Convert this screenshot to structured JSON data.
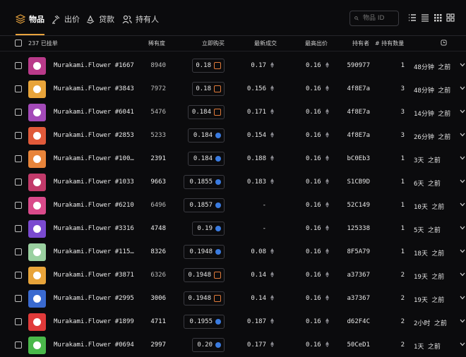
{
  "tabs": [
    {
      "label": "物品",
      "icon": "layers-icon",
      "active": true
    },
    {
      "label": "出价",
      "icon": "gavel-icon",
      "active": false
    },
    {
      "label": "贷款",
      "icon": "loan-icon",
      "active": false
    },
    {
      "label": "持有人",
      "icon": "users-icon",
      "active": false
    }
  ],
  "search": {
    "placeholder": "物品 ID"
  },
  "header": {
    "listed_count": "237 已挂单",
    "rarity": "稀有度",
    "buy_now": "立即购买",
    "last_sale": "最新成交",
    "top_bid": "最高出价",
    "owner": "持有者",
    "qty": "# 持有数量"
  },
  "colors": {
    "accent": "#e8a33d",
    "opensea": "#3a7be0",
    "blur": "#e17b3a"
  },
  "rows": [
    {
      "name": "Murakami.Flower #1667",
      "rarity": "8940",
      "price": "0.18",
      "market": "blur",
      "last": "0.17",
      "bid": "0.16",
      "owner": "590977",
      "qty": "1",
      "time": "48分钟 之前",
      "bg": "#b93a8a"
    },
    {
      "name": "Murakami.Flower #3843",
      "rarity": "7972",
      "price": "0.18",
      "market": "blur",
      "last": "0.156",
      "bid": "0.16",
      "owner": "4f8E7a",
      "qty": "3",
      "time": "48分钟 之前",
      "bg": "#e8a43a"
    },
    {
      "name": "Murakami.Flower #6041",
      "rarity": "5476",
      "price": "0.184",
      "market": "blur",
      "last": "0.171",
      "bid": "0.16",
      "owner": "4f8E7a",
      "qty": "3",
      "time": "14分钟 之前",
      "bg": "#a34ab8"
    },
    {
      "name": "Murakami.Flower #2853",
      "rarity": "5233",
      "price": "0.184",
      "market": "opensea",
      "last": "0.154",
      "bid": "0.16",
      "owner": "4f8E7a",
      "qty": "3",
      "time": "26分钟 之前",
      "bg": "#e05a3a"
    },
    {
      "name": "Murakami.Flower #100…",
      "rarity": "2391",
      "price": "0.184",
      "market": "opensea",
      "last": "0.188",
      "bid": "0.16",
      "owner": "bC0Eb3",
      "qty": "1",
      "time": "3天 之前",
      "bg": "#e8843a"
    },
    {
      "name": "Murakami.Flower #1033",
      "rarity": "9663",
      "price": "0.1855",
      "market": "opensea",
      "last": "0.183",
      "bid": "0.16",
      "owner": "S1CB9D",
      "qty": "1",
      "time": "6天 之前",
      "bg": "#c23a6a"
    },
    {
      "name": "Murakami.Flower #6210",
      "rarity": "6496",
      "price": "0.1857",
      "market": "opensea",
      "last": "-",
      "bid": "0.16",
      "owner": "52C149",
      "qty": "1",
      "time": "10天 之前",
      "bg": "#d94a8a"
    },
    {
      "name": "Murakami.Flower #3316",
      "rarity": "4748",
      "price": "0.19",
      "market": "opensea",
      "last": "-",
      "bid": "0.16",
      "owner": "125338",
      "qty": "1",
      "time": "5天 之前",
      "bg": "#7a4ad0"
    },
    {
      "name": "Murakami.Flower #115…",
      "rarity": "8326",
      "price": "0.1948",
      "market": "opensea",
      "last": "0.08",
      "bid": "0.16",
      "owner": "8F5A79",
      "qty": "1",
      "time": "18天 之前",
      "bg": "#9ad0a0"
    },
    {
      "name": "Murakami.Flower #3871",
      "rarity": "6326",
      "price": "0.1948",
      "market": "blur",
      "last": "0.14",
      "bid": "0.16",
      "owner": "a37367",
      "qty": "2",
      "time": "19天 之前",
      "bg": "#e8a43a"
    },
    {
      "name": "Murakami.Flower #2995",
      "rarity": "3006",
      "price": "0.1948",
      "market": "blur",
      "last": "0.14",
      "bid": "0.16",
      "owner": "a37367",
      "qty": "2",
      "time": "19天 之前",
      "bg": "#3a6ad0"
    },
    {
      "name": "Murakami.Flower #1899",
      "rarity": "4711",
      "price": "0.1955",
      "market": "opensea",
      "last": "0.187",
      "bid": "0.16",
      "owner": "d62F4C",
      "qty": "2",
      "time": "2小时 之前",
      "bg": "#e03a3a"
    },
    {
      "name": "Murakami.Flower #0694",
      "rarity": "2997",
      "price": "0.20",
      "market": "opensea",
      "last": "0.177",
      "bid": "0.16",
      "owner": "50CeD1",
      "qty": "2",
      "time": "1天 之前",
      "bg": "#4ab84a"
    }
  ]
}
